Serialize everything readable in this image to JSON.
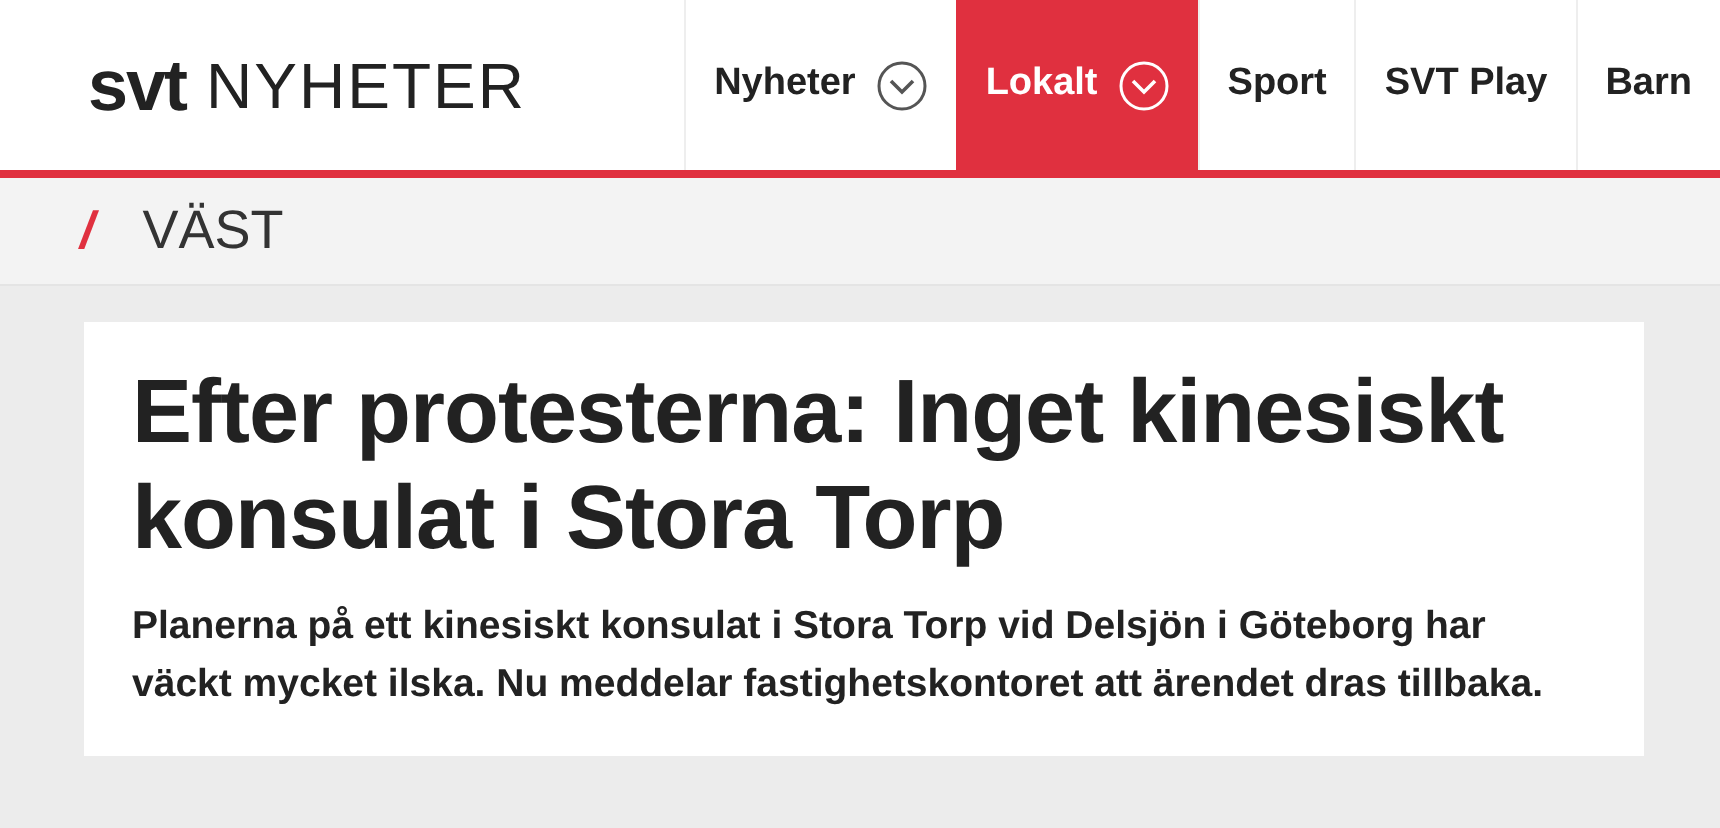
{
  "logo": {
    "brand": "svt",
    "section": "NYHETER"
  },
  "nav": [
    {
      "label": "Nyheter",
      "selected": false,
      "dropdown": true
    },
    {
      "label": "Lokalt",
      "selected": true,
      "dropdown": true
    },
    {
      "label": "Sport",
      "selected": false,
      "dropdown": false
    },
    {
      "label": "SVT Play",
      "selected": false,
      "dropdown": false
    },
    {
      "label": "Barn",
      "selected": false,
      "dropdown": false
    }
  ],
  "region": {
    "mark": "/",
    "name": "VÄST"
  },
  "article": {
    "headline": "Efter protesterna: Inget kinesiskt konsulat i Stora Torp",
    "lead": "Planerna på ett kinesiskt konsulat i Stora Torp vid Delsjön i Göteborg har väckt mycket ilska. Nu meddelar fastighetskontoret att ärendet dras tillbaka."
  }
}
